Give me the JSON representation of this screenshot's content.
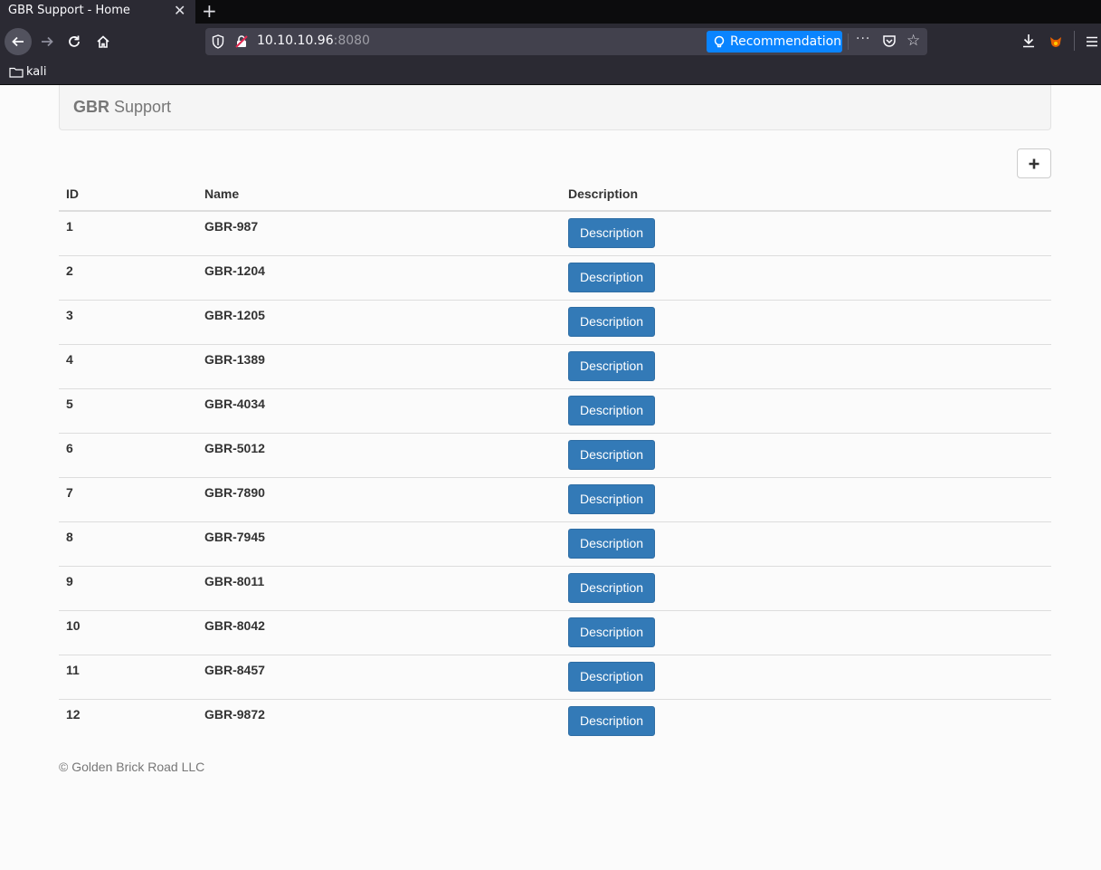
{
  "browser": {
    "tab_title": "GBR Support - Home",
    "url_host": "10.10.10.96",
    "url_port": ":8080",
    "recommendation_label": "Recommendation",
    "more_label": "···",
    "bookmark_folder": "kali"
  },
  "page": {
    "brand_bold": "GBR",
    "brand_rest": "Support",
    "add_button_label": "+",
    "columns": [
      "ID",
      "Name",
      "Description"
    ],
    "description_button_label": "Description",
    "rows": [
      {
        "id": "1",
        "name": "GBR-987"
      },
      {
        "id": "2",
        "name": "GBR-1204"
      },
      {
        "id": "3",
        "name": "GBR-1205"
      },
      {
        "id": "4",
        "name": "GBR-1389"
      },
      {
        "id": "5",
        "name": "GBR-4034"
      },
      {
        "id": "6",
        "name": "GBR-5012"
      },
      {
        "id": "7",
        "name": "GBR-7890"
      },
      {
        "id": "8",
        "name": "GBR-7945"
      },
      {
        "id": "9",
        "name": "GBR-8011"
      },
      {
        "id": "10",
        "name": "GBR-8042"
      },
      {
        "id": "11",
        "name": "GBR-8457"
      },
      {
        "id": "12",
        "name": "GBR-9872"
      }
    ],
    "footer": "© Golden Brick Road LLC"
  },
  "colors": {
    "primary_button": "#337ab7",
    "recommendation": "#0a84ff"
  }
}
